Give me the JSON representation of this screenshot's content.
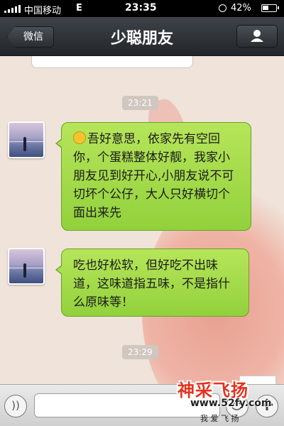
{
  "status_bar": {
    "carrier": "中国移动",
    "network": "E",
    "time": "23:35",
    "battery": "42%"
  },
  "nav": {
    "back_label": "微信",
    "title": "少聪朋友"
  },
  "chat": {
    "timestamps": [
      "23:21",
      "23:29"
    ],
    "messages": [
      {
        "sender": "friend",
        "emoji": "smile-emoji",
        "text": "吾好意思，依家先有空回你，个蛋糕整体好靓，我家小朋友见到好开心,小朋友说不可切坏个公仔，大人只好横切个面出来先"
      },
      {
        "sender": "friend",
        "text": "吃也好松软，但好吃不出味道，这味道指五味，不是指什么原味等！"
      }
    ]
  },
  "input_bar": {
    "value": "",
    "placeholder": ""
  },
  "watermark": {
    "title": "神采飞扬",
    "url": "www.52fy.com",
    "slogan": "我 爱 飞 扬"
  },
  "colors": {
    "bubble": "#a4dc4e",
    "nav": "#2f3338",
    "background": "#efe3da"
  }
}
